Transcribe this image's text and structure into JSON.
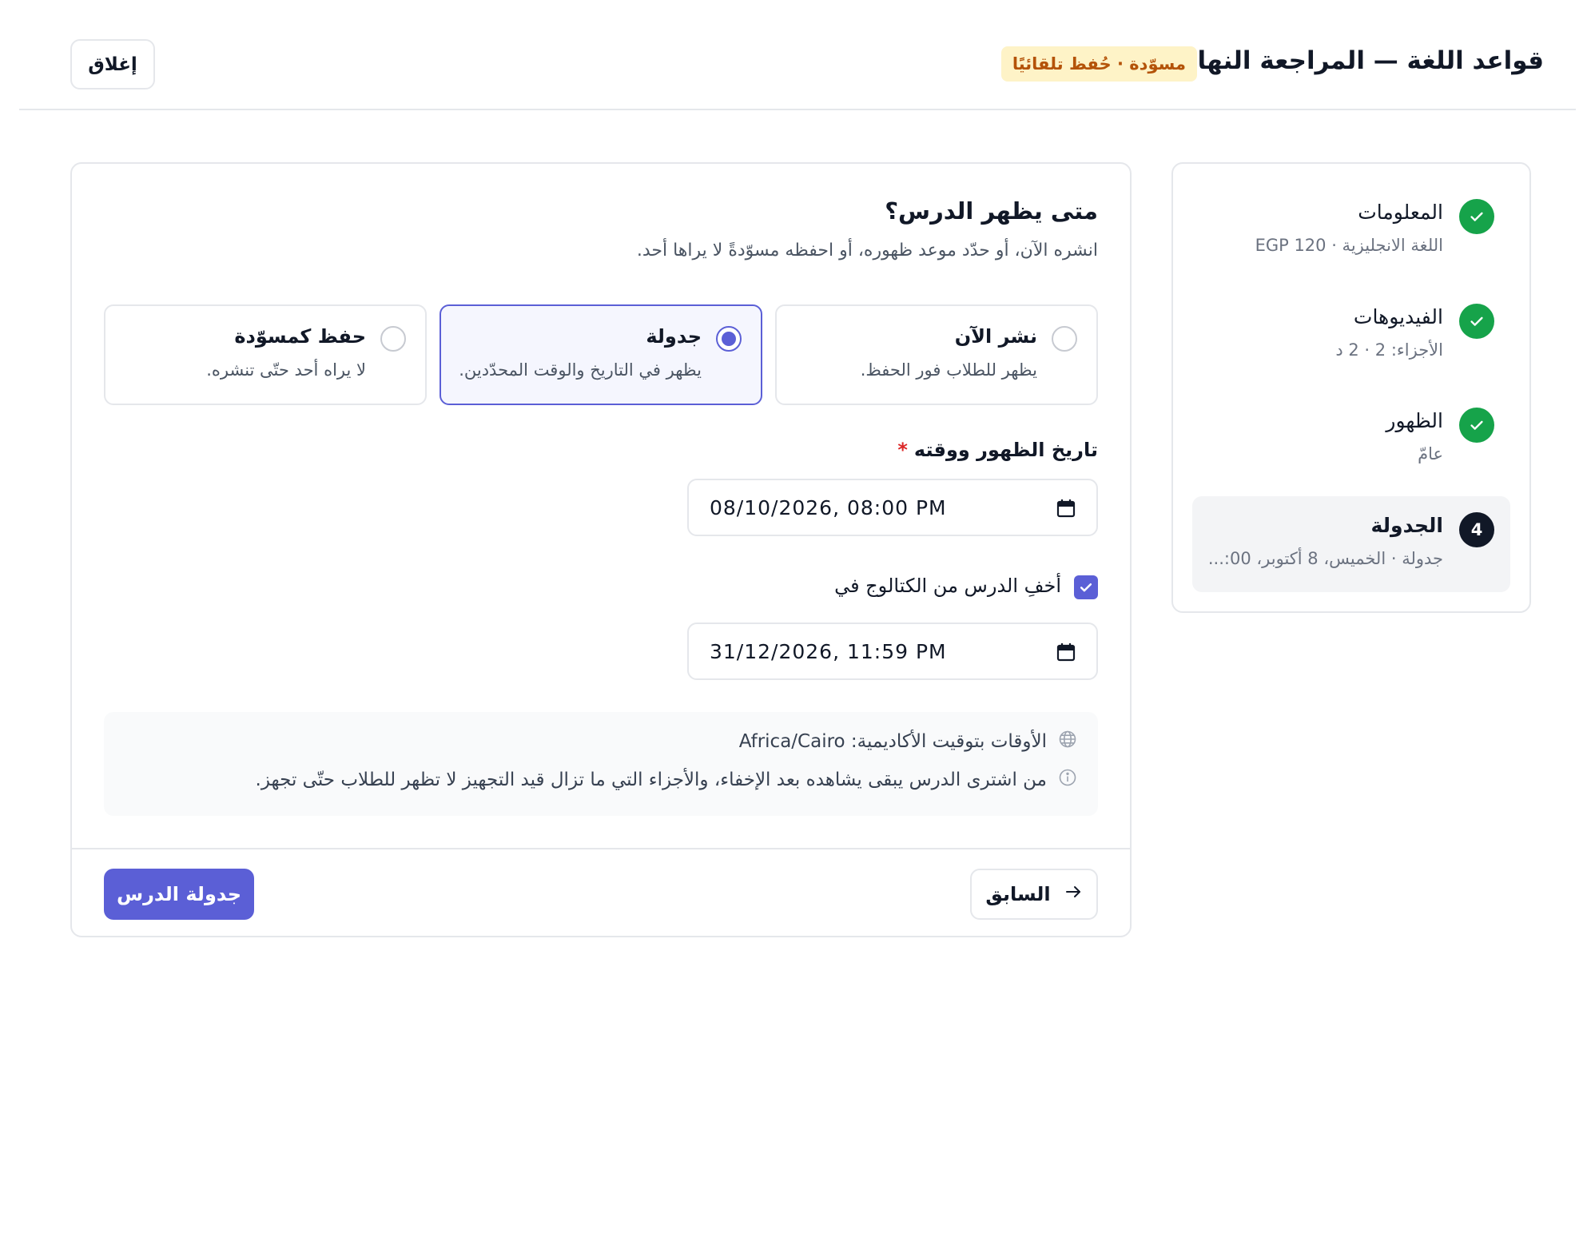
{
  "header": {
    "title": "قواعد اللغة — المراجعة النهائية",
    "draft_badge": "مسوّدة · حُفظ تلقائيًا",
    "close_label": "إغلاق"
  },
  "steps": [
    {
      "title": "المعلومات",
      "subtitle": "اللغة الانجليزية · EGP 120",
      "status": "done"
    },
    {
      "title": "الفيديوهات",
      "subtitle": "الأجزاء: 2 · 2 د",
      "status": "done"
    },
    {
      "title": "الظهور",
      "subtitle": "عامّ",
      "status": "done"
    },
    {
      "title": "الجدولة",
      "subtitle": "جدولة · الخميس، 8 أكتوبر، 00:...",
      "status": "current",
      "number": "4"
    }
  ],
  "main": {
    "question": "متى يظهر الدرس؟",
    "question_sub": "انشره الآن، أو حدّد موعد ظهوره، أو احفظه مسوّدةً لا يراها أحد.",
    "options": [
      {
        "title": "نشر الآن",
        "desc": "يظهر للطلاب فور الحفظ.",
        "selected": false
      },
      {
        "title": "جدولة",
        "desc": "يظهر في التاريخ والوقت المحدّدين.",
        "selected": true
      },
      {
        "title": "حفظ كمسوّدة",
        "desc": "لا يراه أحد حتّى تنشره.",
        "selected": false
      }
    ],
    "publish_label": "تاريخ الظهور ووقته",
    "required_mark": "*",
    "publish_datetime": "08/10/2026, 08:00 PM",
    "hide_checkbox_label": "أخفِ الدرس من الكتالوج في",
    "hide_checked": true,
    "hide_datetime": "31/12/2026, 11:59 PM",
    "info_timezone": "الأوقات بتوقيت الأكاديمية: Africa/Cairo",
    "info_note": "من اشترى الدرس يبقى يشاهده بعد الإخفاء، والأجزاء التي ما تزال قيد التجهيز لا تظهر للطلاب حتّى تجهز."
  },
  "footer": {
    "prev_label": "السابق",
    "primary_label": "جدولة الدرس"
  },
  "colors": {
    "accent": "#5b5fd6",
    "success": "#16a34a",
    "badge_bg": "#fef3c7",
    "badge_text": "#b45309",
    "required": "#dc2626"
  }
}
